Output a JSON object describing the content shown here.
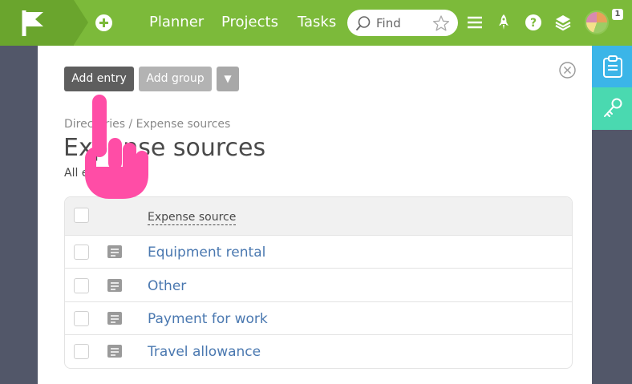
{
  "topbar": {
    "nav": [
      "Planner",
      "Projects",
      "Tasks"
    ],
    "search": {
      "placeholder": "Find",
      "value": ""
    },
    "notification_count": "1",
    "icons": [
      "flag-logo-icon",
      "plus-circle-icon",
      "search-icon",
      "star-icon",
      "menu-icon",
      "rocket-icon",
      "help-icon",
      "layers-icon"
    ]
  },
  "toolbar": {
    "add_entry_label": "Add entry",
    "add_group_label": "Add group",
    "dropdown_label": "▼"
  },
  "page": {
    "breadcrumb": "Directories / Expense sources",
    "title": "Expense sources",
    "subtitle": "All entries"
  },
  "table": {
    "column_header": "Expense source",
    "rows": [
      "Equipment rental",
      "Other",
      "Payment for work",
      "Travel allowance"
    ]
  },
  "rail": {
    "icons": [
      "clipboard-icon",
      "key-icon"
    ]
  },
  "colors": {
    "topbar": "#7cba3a",
    "rail_blue": "#3bb5e8",
    "rail_teal": "#4ad9b0",
    "link": "#4a78b0",
    "pointer": "#ff4da6"
  }
}
